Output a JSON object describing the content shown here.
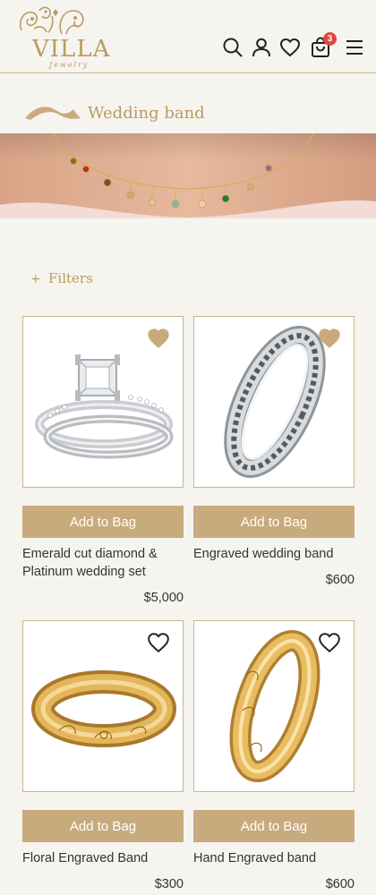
{
  "brand": {
    "name": "VILLA",
    "tagline": "Jewelry"
  },
  "header": {
    "cart_count": "3"
  },
  "page": {
    "title": "Wedding band"
  },
  "filters": {
    "label": "Filters"
  },
  "colors": {
    "accent": "#c8ab7d",
    "gold_text": "#b99a63",
    "badge": "#e0473b",
    "background": "#f6f4ef"
  },
  "products": [
    {
      "name": "Emerald cut diamond & Platinum wedding set",
      "price": "$5,000",
      "button": "Add to Bag",
      "favorited": true,
      "image": "diamond-platinum-set"
    },
    {
      "name": "Engraved wedding band",
      "price": "$600",
      "button": "Add to Bag",
      "favorited": true,
      "image": "silver-engraved-band"
    },
    {
      "name": "Floral Engraved Band",
      "price": "$300",
      "button": "Add to Bag",
      "favorited": false,
      "image": "gold-floral-band"
    },
    {
      "name": "Hand Engraved band",
      "price": "$600",
      "button": "Add to Bag",
      "favorited": false,
      "image": "gold-hand-engraved-band"
    }
  ]
}
